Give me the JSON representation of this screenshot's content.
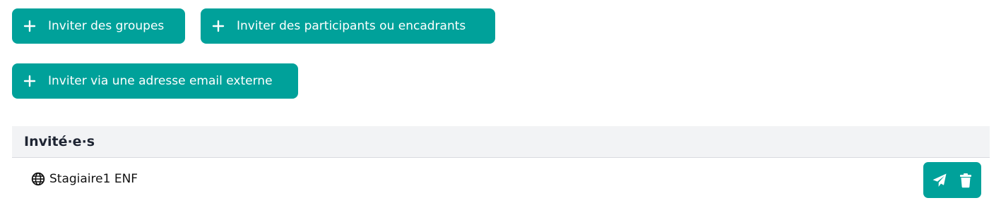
{
  "buttons": {
    "invite_groups": "Inviter des groupes",
    "invite_participants": "Inviter des participants ou encadrants",
    "invite_email": "Inviter via une adresse email externe"
  },
  "invitees": {
    "header": "Invité·e·s",
    "items": [
      {
        "name": "Stagiaire1 ENF",
        "icon": "globe-icon"
      }
    ]
  },
  "colors": {
    "accent": "#00a19a",
    "header_bg": "#f2f3f5",
    "header_text": "#1f2533"
  },
  "icons": {
    "plus": "plus-icon",
    "send": "paper-plane-icon",
    "delete": "trash-icon"
  }
}
